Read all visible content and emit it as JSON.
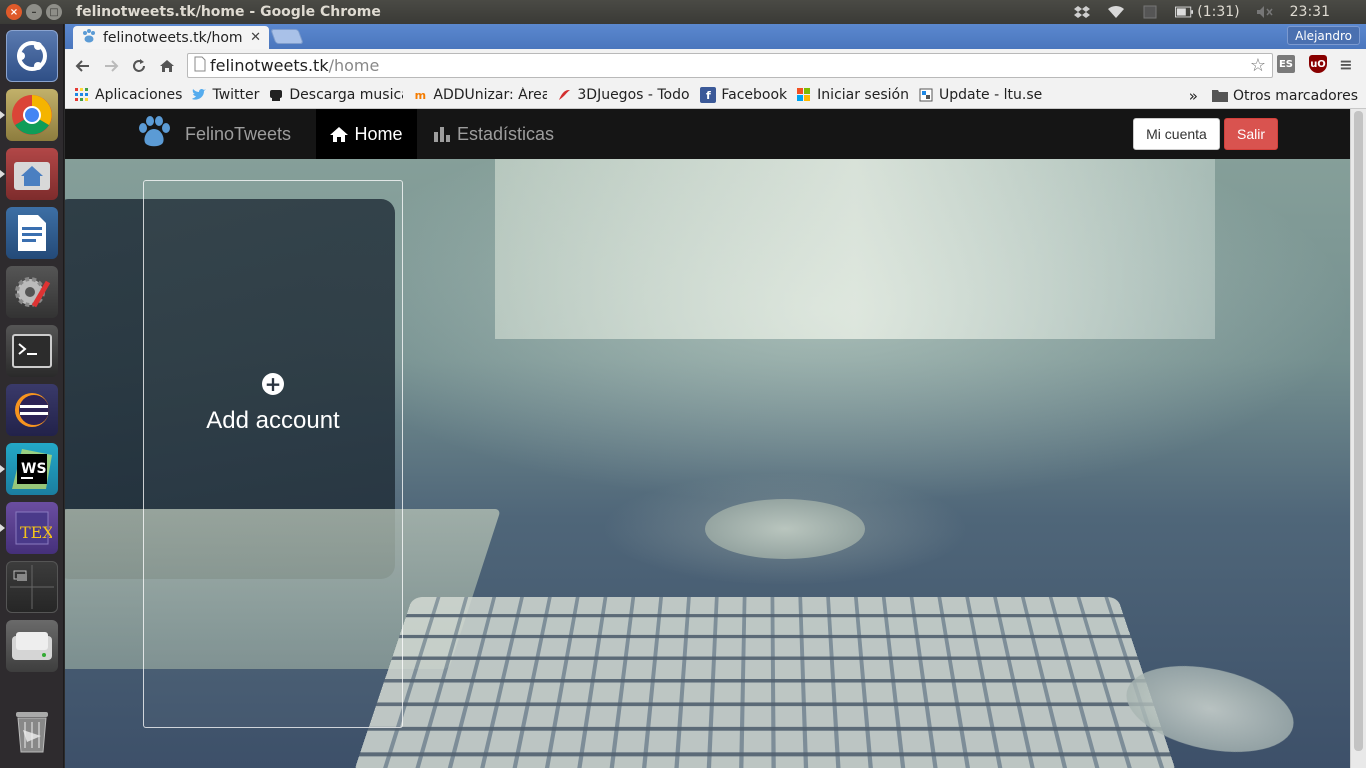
{
  "window": {
    "title": "felinotweets.tk/home - Google Chrome"
  },
  "tray": {
    "battery": "(1:31)",
    "clock": "23:31"
  },
  "browser": {
    "tab_title": "felinotweets.tk/hom",
    "profile": "Alejandro",
    "url_host": "felinotweets.tk",
    "url_path": "/home",
    "ext_es": "ES",
    "ext_ub": "uO",
    "bookmarks": [
      {
        "label": "Aplicaciones",
        "icon": "apps-grid-icon"
      },
      {
        "label": "Twitter",
        "icon": "twitter-bird-icon"
      },
      {
        "label": "Descarga musica",
        "icon": "download-icon"
      },
      {
        "label": "ADDUnizar: Área",
        "icon": "moodle-icon"
      },
      {
        "label": "3DJuegos - Todo",
        "icon": "3djuegos-icon"
      },
      {
        "label": "Facebook",
        "icon": "facebook-icon"
      },
      {
        "label": "Iniciar sesión",
        "icon": "microsoft-icon"
      },
      {
        "label": "Update - ltu.se",
        "icon": "page-icon"
      }
    ],
    "overflow": "»",
    "other_bookmarks": "Otros marcadores"
  },
  "app": {
    "brand": "FelinoTweets",
    "nav": {
      "home": "Home",
      "stats": "Estadísticas"
    },
    "buttons": {
      "account": "Mi cuenta",
      "exit": "Salir"
    },
    "card": {
      "add_label": "Add account"
    },
    "colors": {
      "navbar": "#151515",
      "exit": "#d9534f",
      "accent": "#5b9bd5"
    }
  }
}
